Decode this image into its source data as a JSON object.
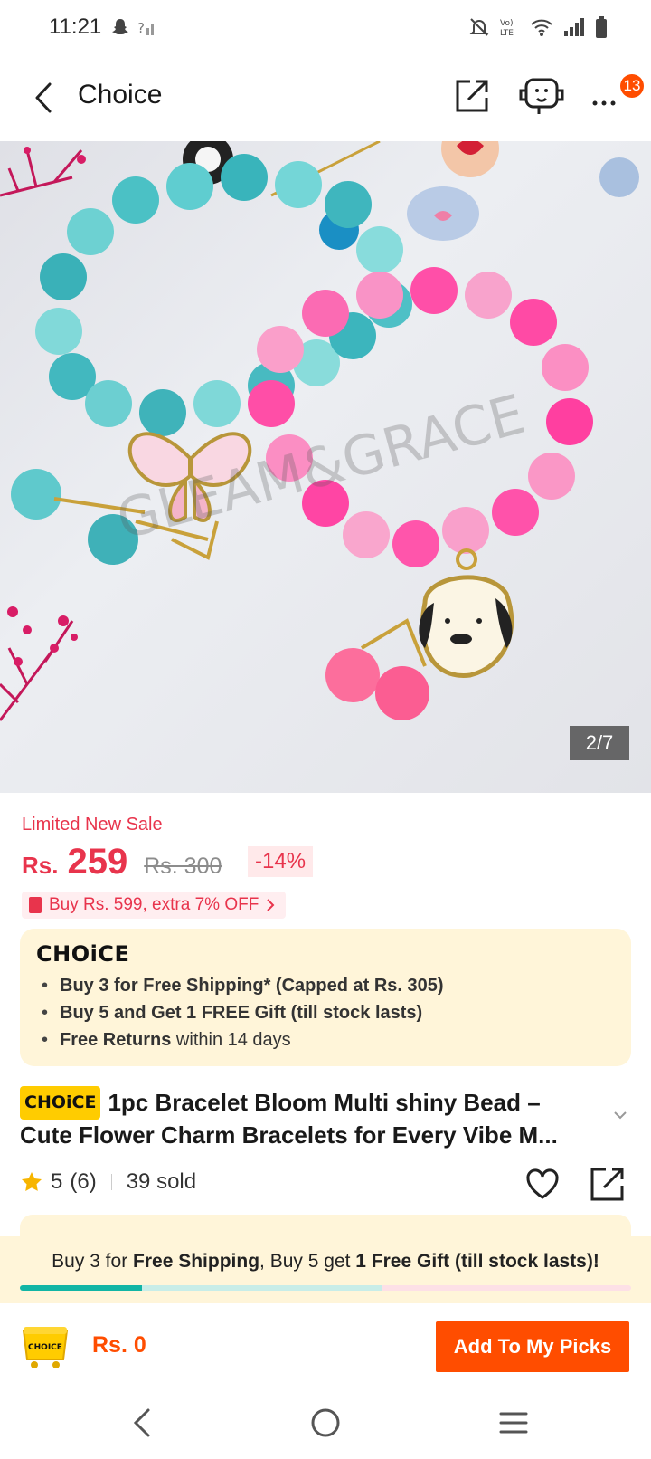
{
  "status_bar": {
    "time": "11:21"
  },
  "header": {
    "title": "Choice",
    "more_badge": "13"
  },
  "gallery": {
    "counter": "2/7",
    "watermark": "GLEAM&GRACE"
  },
  "price": {
    "sale_label": "Limited New Sale",
    "currency": "Rs.",
    "current": "259",
    "original": "Rs. 300",
    "discount": "-14%",
    "promo": "Buy Rs. 599, extra 7% OFF"
  },
  "choice_box": {
    "logo": "CHOiCE",
    "items": [
      {
        "bold": "Buy 3 for  Free Shipping* (Capped at Rs. 305)",
        "rest": ""
      },
      {
        "bold": "Buy 5 and Get 1 FREE Gift (till stock lasts)",
        "rest": ""
      },
      {
        "bold": "Free Returns",
        "rest": " within 14 days"
      }
    ]
  },
  "product": {
    "tag": "CHOiCE",
    "title_line1": "1pc Bracelet Bloom Multi shiny Bead –",
    "title_line2": "Cute Flower Charm Bracelets for Every Vibe M..."
  },
  "rating": {
    "score": "5",
    "count": "(6)",
    "sold": "39 sold"
  },
  "banner": {
    "p1": "Buy 3 for ",
    "b1": "Free Shipping",
    "p2": ", Buy 5 get ",
    "b2": "1 Free Gift (till stock lasts)!",
    "progress_fraction": 0.2
  },
  "bottom_bar": {
    "cart_label": "CHOICE",
    "cart_total": "Rs. 0",
    "add_button": "Add To My Picks"
  },
  "colors": {
    "accent": "#ff4d00",
    "price_red": "#e8344c",
    "choice_yellow": "#ffcc00",
    "choice_bg": "#fff5d9",
    "progress_teal": "#12b5a5"
  }
}
